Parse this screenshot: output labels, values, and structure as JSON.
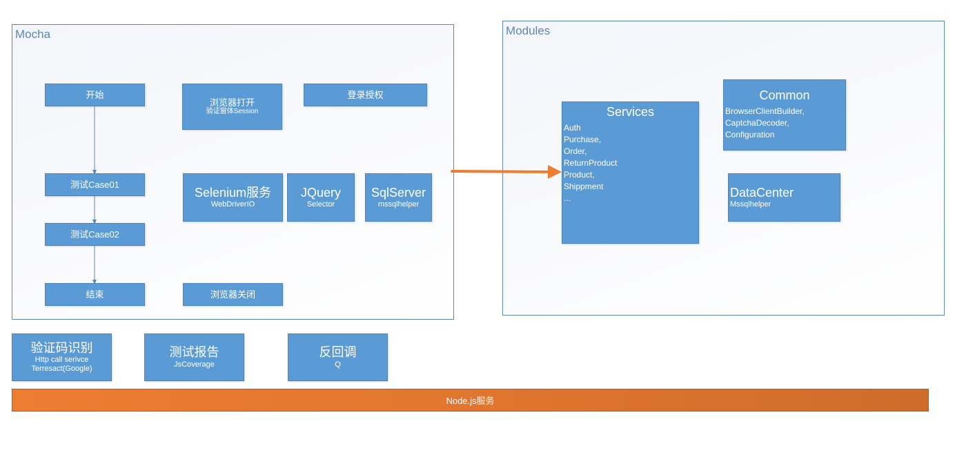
{
  "mocha": {
    "title": "Mocha",
    "flow": {
      "start": "开始",
      "case01": "测试Case01",
      "case02": "测试Case02",
      "end": "结束"
    },
    "browser_open": {
      "title": "浏览器打开",
      "subtitle": "验证窗体Session"
    },
    "login": {
      "title": "登录授权"
    },
    "selenium": {
      "title": "Selenium服务",
      "subtitle": "WebDriverIO"
    },
    "jquery": {
      "title": "JQuery",
      "subtitle": "Selector"
    },
    "sqlserver": {
      "title": "SqlServer",
      "subtitle": "mssqlhelper"
    },
    "browser_close": {
      "title": "浏览器关闭"
    }
  },
  "modules": {
    "title": "Modules",
    "services": {
      "title": "Services",
      "items": [
        "Auth",
        "Purchase,",
        "Order,",
        "ReturnProduct",
        "Product,",
        "Shippment",
        "..."
      ]
    },
    "common": {
      "title": "Common",
      "items": [
        "BrowserClientBuilder,",
        "CaptchaDecoder,",
        "Configuration"
      ]
    },
    "datacenter": {
      "title": "DataCenter",
      "subtitle": "Mssqlhelper"
    }
  },
  "bottom": {
    "captcha": {
      "title": "验证码识别",
      "line1": "Http call serivce",
      "line2": "Terresact(Google)"
    },
    "report": {
      "title": "测试报告",
      "subtitle": "JsCoverage"
    },
    "callback": {
      "title": "反回调",
      "subtitle": "Q"
    }
  },
  "platform": {
    "label": "Node.js服务"
  },
  "colors": {
    "node_fill": "#5b9bd5",
    "group_border": "#5b87b5",
    "platform_fill": "#ed7d31",
    "arrow": "#ed7d31",
    "flow_line": "#5b87b5"
  }
}
